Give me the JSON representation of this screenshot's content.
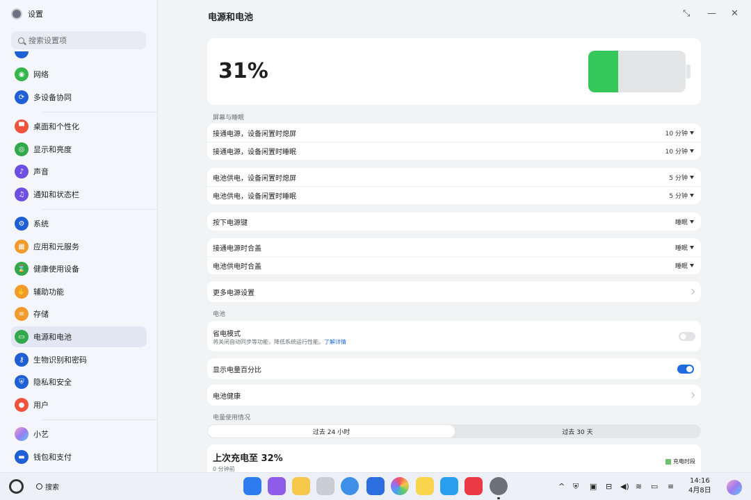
{
  "sidebar": {
    "title": "设置",
    "search_placeholder": "搜索设置项",
    "items": [
      {
        "label": "网络",
        "icon": "network-icon",
        "color": "#35b64b"
      },
      {
        "label": "多设备协同",
        "icon": "devices-icon",
        "color": "#1f5fd6"
      },
      {
        "label": "桌面和个性化",
        "icon": "paint-icon",
        "color": "#f0533d"
      },
      {
        "label": "显示和亮度",
        "icon": "eye-icon",
        "color": "#31a84a"
      },
      {
        "label": "声音",
        "icon": "speaker-icon",
        "color": "#6e4ee3"
      },
      {
        "label": "通知和状态栏",
        "icon": "bell-icon",
        "color": "#6e4ee3"
      },
      {
        "label": "系统",
        "icon": "gear-icon",
        "color": "#1f5fd6"
      },
      {
        "label": "应用和元服务",
        "icon": "apps-icon",
        "color": "#f29a2c"
      },
      {
        "label": "健康使用设备",
        "icon": "hourglass-icon",
        "color": "#31a84a"
      },
      {
        "label": "辅助功能",
        "icon": "hand-icon",
        "color": "#f29a2c"
      },
      {
        "label": "存储",
        "icon": "storage-icon",
        "color": "#f29a2c"
      },
      {
        "label": "电源和电池",
        "icon": "battery-icon",
        "color": "#31a84a"
      },
      {
        "label": "生物识别和密码",
        "icon": "key-icon",
        "color": "#1f5fd6"
      },
      {
        "label": "隐私和安全",
        "icon": "shield-icon",
        "color": "#1f5fd6"
      },
      {
        "label": "用户",
        "icon": "user-icon",
        "color": "#f0533d"
      },
      {
        "label": "小艺",
        "icon": "assistant-icon",
        "color": "#b57be8"
      },
      {
        "label": "钱包和支付",
        "icon": "wallet-icon",
        "color": "#1f5fd6"
      }
    ]
  },
  "main": {
    "title": "电源和电池",
    "battery_percent": "31%",
    "battery_level": 0.31,
    "section_screen": "屏幕与睡眠",
    "plugged_off_label": "接通电源，设备闲置时熄屏",
    "plugged_off_value": "10 分钟",
    "plugged_sleep_label": "接通电源，设备闲置时睡眠",
    "plugged_sleep_value": "10 分钟",
    "battery_off_label": "电池供电，设备闲置时熄屏",
    "battery_off_value": "5 分钟",
    "battery_sleep_label": "电池供电，设备闲置时睡眠",
    "battery_sleep_value": "5 分钟",
    "power_key_label": "按下电源键",
    "power_key_value": "睡眠",
    "lid_plugged_label": "接通电源时合盖",
    "lid_plugged_value": "睡眠",
    "lid_battery_label": "电池供电时合盖",
    "lid_battery_value": "睡眠",
    "more_settings": "更多电源设置",
    "section_battery": "电池",
    "saver_title": "省电模式",
    "saver_desc": "将关闭自动同步等功能，降低系统运行性能。",
    "saver_link": "了解详情",
    "saver_on": false,
    "show_percent_label": "显示电量百分比",
    "show_percent_on": true,
    "battery_health": "电池健康",
    "section_usage": "电量使用情况",
    "tab_24h": "过去 24 小时",
    "tab_30d": "过去 30 天",
    "last_charge": "上次充电至 32%",
    "last_charge_time": "0 分钟前",
    "legend_charging": "充电时段",
    "accent_color": "#1f6be0",
    "battery_fill_color": "#35c759"
  },
  "taskbar": {
    "search_label": "搜索",
    "apps": [
      "windows-icon",
      "window-manager-icon",
      "files-icon",
      "trash-icon",
      "browser-icon",
      "mail-icon",
      "photos-icon",
      "notes-icon",
      "docs-icon",
      "appgallery-icon",
      "settings-icon"
    ],
    "time": "14:16",
    "date": "4月8日"
  }
}
